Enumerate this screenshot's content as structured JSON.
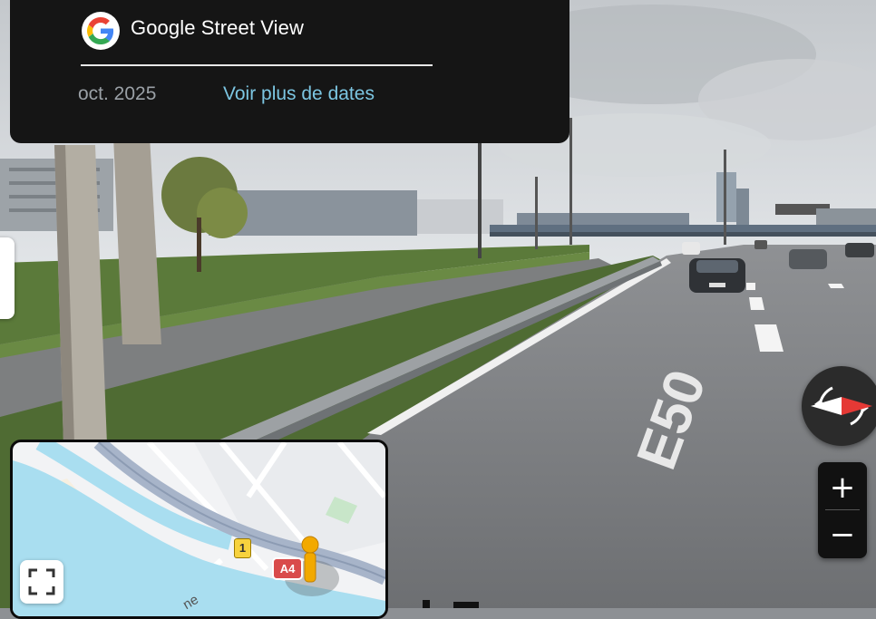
{
  "header": {
    "app_title": "Google Street View",
    "date": "oct. 2025",
    "more_dates_link": "Voir plus de dates"
  },
  "scene": {
    "road_marking": "E50"
  },
  "controls": {
    "zoom_in": "+",
    "zoom_out": "−"
  },
  "minimap": {
    "road_badge": "A4",
    "marker_badge": "1",
    "street_label_fragment": "ne"
  },
  "colors": {
    "header_bg": "#151515",
    "link": "#7cc6e2",
    "date_text": "#9aa0a6",
    "river": "#a9def0",
    "highway": "#a7b4c9",
    "pegman": "#f2a900",
    "a4_badge": "#d94b4b",
    "compass_red": "#e53935"
  },
  "icons": {
    "logo": "google-g-icon",
    "compass": "compass-icon",
    "expand": "fullscreen-icon",
    "pegman": "pegman-icon"
  }
}
